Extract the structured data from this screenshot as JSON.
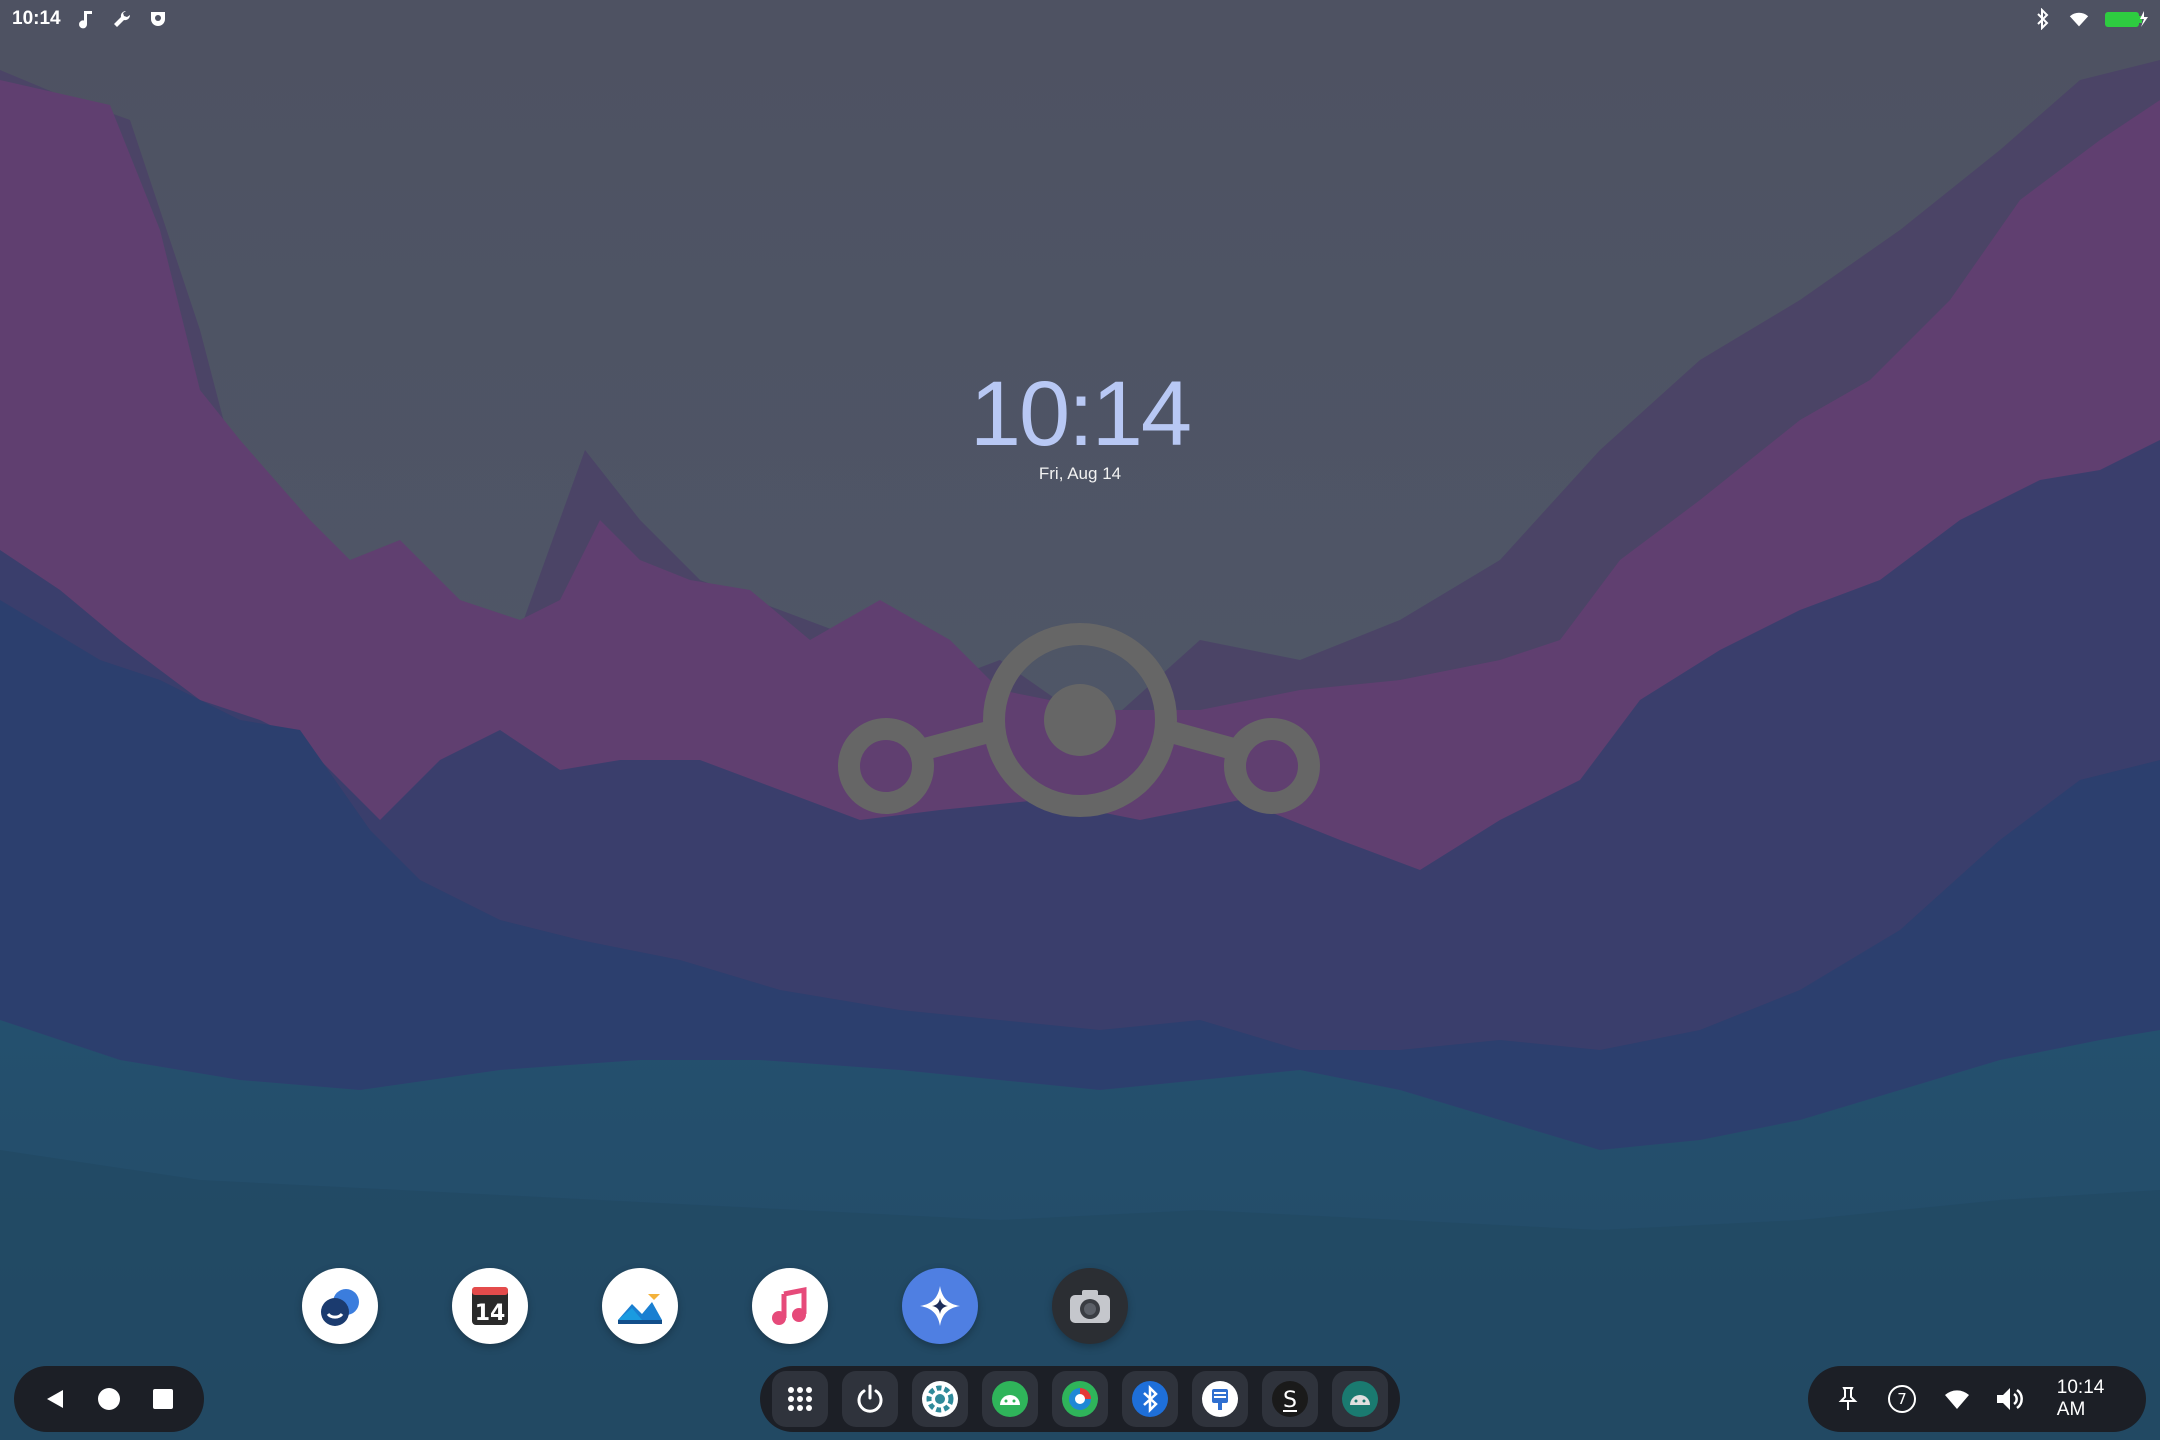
{
  "status_bar": {
    "time": "10:14",
    "left_icons": [
      "music-note-icon",
      "wrench-icon",
      "shield-app-icon"
    ],
    "right_icons": [
      "bluetooth-icon",
      "wifi-icon",
      "battery-charging-icon"
    ]
  },
  "clock_widget": {
    "time": "10:14",
    "date": "Fri, Aug 14"
  },
  "center_logo": {
    "icon": "lineageos-logo-icon"
  },
  "dock": {
    "apps": [
      {
        "name": "Messaging",
        "icon": "messaging-icon"
      },
      {
        "name": "Calendar",
        "icon": "calendar-icon",
        "text": "14"
      },
      {
        "name": "Gallery",
        "icon": "gallery-icon"
      },
      {
        "name": "Music",
        "icon": "music-icon"
      },
      {
        "name": "Assistant",
        "icon": "sparkle-icon"
      },
      {
        "name": "Camera",
        "icon": "camera-icon"
      }
    ]
  },
  "nav_bar": {
    "buttons": [
      "back-icon",
      "home-icon",
      "recents-icon"
    ]
  },
  "taskbar": {
    "buttons": [
      "app-drawer-icon",
      "power-icon",
      "settings-app-icon",
      "android-app-icon",
      "browser-app-icon",
      "bluetooth-app-icon",
      "file-manager-icon",
      "s-app-icon",
      "android-dark-icon"
    ]
  },
  "tray": {
    "pin_icon": "pin-icon",
    "notification_count": "7",
    "wifi_icon": "wifi-icon",
    "volume_icon": "volume-icon",
    "time": "10:14 AM"
  },
  "colors": {
    "clock": "#b8c8f4",
    "panel": "#1c1f26",
    "sky": "#4e5568",
    "mountain_purple": "#6b3e73",
    "mountain_blue": "#2c4b77",
    "mountain_teal": "#21506b",
    "accent_green": "#2ecc40"
  }
}
